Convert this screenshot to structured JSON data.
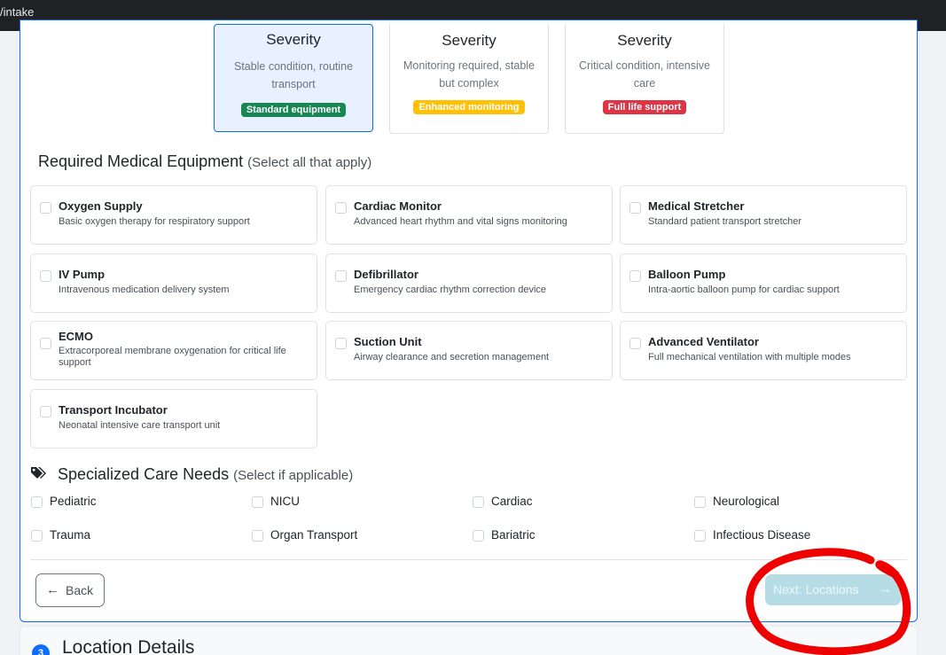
{
  "browser": {
    "url": "/intake"
  },
  "severity_cards": [
    {
      "title": "Severity",
      "description": "Stable condition, routine transport",
      "badge": "Standard equipment",
      "badge_color": "#198754",
      "selected": true
    },
    {
      "title": "Severity",
      "description": "Monitoring required, stable but complex",
      "badge": "Enhanced monitoring",
      "badge_color": "#ffc107",
      "selected": false
    },
    {
      "title": "Severity",
      "description": "Critical condition, intensive care",
      "badge": "Full life support",
      "badge_color": "#dc3545",
      "selected": false
    }
  ],
  "equipment": {
    "title": "Required Medical Equipment",
    "subtitle": "(Select all that apply)",
    "items": [
      {
        "name": "Oxygen Supply",
        "description": "Basic oxygen therapy for respiratory support"
      },
      {
        "name": "Cardiac Monitor",
        "description": "Advanced heart rhythm and vital signs monitoring"
      },
      {
        "name": "Medical Stretcher",
        "description": "Standard patient transport stretcher"
      },
      {
        "name": "IV Pump",
        "description": "Intravenous medication delivery system"
      },
      {
        "name": "Defibrillator",
        "description": "Emergency cardiac rhythm correction device"
      },
      {
        "name": "Balloon Pump",
        "description": "Intra-aortic balloon pump for cardiac support"
      },
      {
        "name": "ECMO",
        "description": "Extracorporeal membrane oxygenation for critical life support"
      },
      {
        "name": "Suction Unit",
        "description": "Airway clearance and secretion management"
      },
      {
        "name": "Advanced Ventilator",
        "description": "Full mechanical ventilation with multiple modes"
      },
      {
        "name": "Transport Incubator",
        "description": "Neonatal intensive care transport unit"
      }
    ]
  },
  "care_needs": {
    "icon": "tags-icon",
    "title": "Specialized Care Needs",
    "subtitle": "(Select if applicable)",
    "items": [
      "Pediatric",
      "NICU",
      "Cardiac",
      "Neurological",
      "Trauma",
      "Organ Transport",
      "Bariatric",
      "Infectious Disease"
    ]
  },
  "nav": {
    "back_label": "Back",
    "next_label": "Next: Locations",
    "next_disabled": true
  },
  "next_section": {
    "number": "3",
    "title": "Location Details"
  },
  "colors": {
    "primary": "#0d6efd",
    "annotation": "#ee0000"
  }
}
